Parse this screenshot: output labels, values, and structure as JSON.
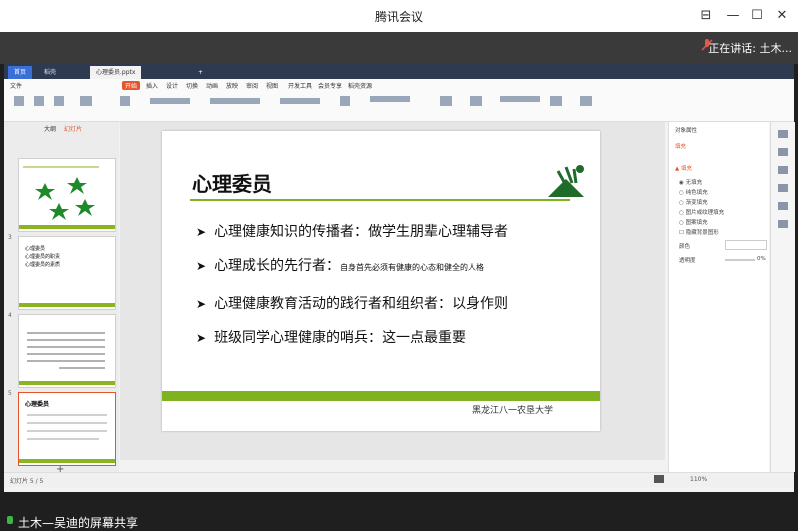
{
  "window": {
    "title": "腾讯会议",
    "speaking_label": "正在讲话: 土木..."
  },
  "wps": {
    "tabs": [
      "首页",
      "稻壳",
      "心理委员.pptx"
    ],
    "menu": [
      "文件",
      "开始",
      "插入",
      "设计",
      "切换",
      "动画",
      "放映",
      "审阅",
      "视图",
      "开发工具",
      "会员专享",
      "稻壳资源"
    ],
    "status_left": "幻灯片 5 / 5",
    "status_zoom": "110%"
  },
  "slide": {
    "title": "心理委员",
    "bullets": [
      {
        "lead": "心理健康知识的传播者：",
        "hand": "做学生朋辈心理辅导者"
      },
      {
        "lead": "心理成长的先行者：",
        "hand": "自身首先必须有健康的心态和健全的人格"
      },
      {
        "lead": "心理健康教育活动的践行者和组织者：",
        "hand": "以身作则"
      },
      {
        "lead": "班级同学心理健康的哨兵：",
        "hand": "这一点最重要"
      }
    ],
    "footer": "黑龙江八一农垦大学"
  },
  "thumbs": {
    "t3_lines": [
      "心理委员",
      "心理委员的职责",
      "心理委员的素质"
    ],
    "t5_title": "心理委员"
  },
  "rightpanel": {
    "heading": "对象属性",
    "tab": "填充",
    "options": [
      "无填充",
      "纯色填充",
      "渐变填充",
      "图片或纹理填充",
      "图案填充",
      "隐藏背景图形"
    ],
    "color_label": "颜色",
    "transparency_label": "透明度",
    "transparency_value": "0%"
  },
  "share": {
    "label": "土木—吴迪的屏幕共享"
  },
  "colors": {
    "accent_green": "#7fb21e",
    "tab_active": "#e8542a",
    "meeting_bg": "#3a3a3a"
  }
}
